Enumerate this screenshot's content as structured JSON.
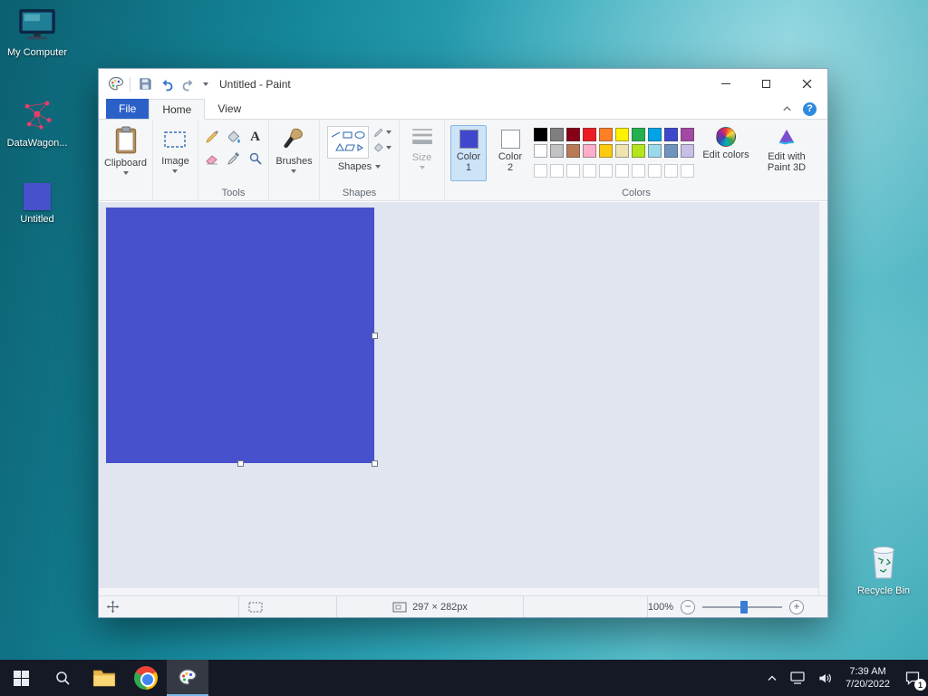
{
  "desktop": {
    "icons": {
      "my_computer": "My Computer",
      "datawagon": "DataWagon...",
      "untitled": "Untitled",
      "recycle_bin": "Recycle Bin"
    }
  },
  "window": {
    "title": "Untitled - Paint"
  },
  "tabs": {
    "file": "File",
    "home": "Home",
    "view": "View",
    "help": "?"
  },
  "ribbon": {
    "clipboard_label": "Clipboard",
    "image_label": "Image",
    "tools_group_label": "Tools",
    "text_tool_glyph": "A",
    "brushes_label": "Brushes",
    "shapes_caption": "Shapes",
    "shapes_group_label": "Shapes",
    "size_label": "Size",
    "colors": {
      "group_label": "Colors",
      "color1_line1": "Color",
      "color1_line2": "1",
      "color2_line1": "Color",
      "color2_line2": "2",
      "color1_value": "#3f48cc",
      "color2_value": "#ffffff",
      "edit_colors_label": "Edit colors",
      "edit_3d_label": "Edit with Paint 3D",
      "palette": [
        [
          "#000000",
          "#7f7f7f",
          "#880015",
          "#ed1c24",
          "#ff7f27",
          "#fff200",
          "#22b14c",
          "#00a2e8",
          "#3f48cc",
          "#a349a4"
        ],
        [
          "#ffffff",
          "#c3c3c3",
          "#b97a57",
          "#ffaec9",
          "#ffc90e",
          "#efe4b0",
          "#b5e61d",
          "#99d9ea",
          "#7092be",
          "#c8bfe7"
        ],
        [
          null,
          null,
          null,
          null,
          null,
          null,
          null,
          null,
          null,
          null
        ]
      ]
    }
  },
  "canvas": {
    "fill": "#4751cb"
  },
  "statusbar": {
    "selection_size": "297 × 282px",
    "zoom_level": "100%",
    "zoom_out_glyph": "−",
    "zoom_in_glyph": "+"
  },
  "taskbar": {
    "time": "7:39 AM",
    "date": "7/20/2022",
    "notification_count": "1"
  }
}
